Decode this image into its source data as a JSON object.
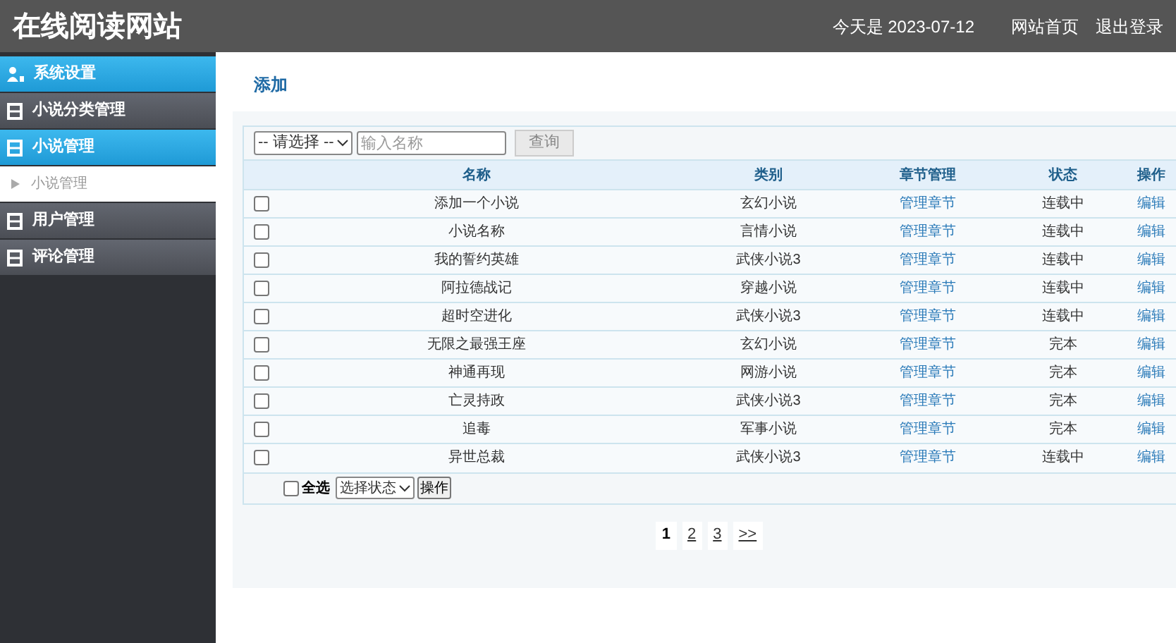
{
  "header": {
    "title": "在线阅读网站",
    "date": "今天是 2023-07-12",
    "links": [
      "网站首页",
      "退出登录"
    ]
  },
  "sidebar": {
    "items": [
      {
        "label": "系统设置",
        "kind": "group",
        "selected": true
      },
      {
        "label": "小说分类管理",
        "kind": "group",
        "selected": false
      },
      {
        "label": "小说管理",
        "kind": "group",
        "selected": true
      },
      {
        "label": "小说管理",
        "kind": "sub",
        "selected": false
      },
      {
        "label": "用户管理",
        "kind": "group",
        "selected": false
      },
      {
        "label": "评论管理",
        "kind": "group",
        "selected": false
      }
    ]
  },
  "add_link": "添加",
  "filter": {
    "select": "-- 请选择 --",
    "placeholder": "输入名称",
    "button": "查询"
  },
  "table": {
    "columns": [
      "名称",
      "类别",
      "章节管理",
      "状态",
      "操作"
    ],
    "rows": [
      {
        "checked": false,
        "name": "添加一个小说",
        "category": "玄幻小说",
        "chapters": "管理章节",
        "status": "连载中",
        "action": "编辑"
      },
      {
        "checked": false,
        "name": "小说名称",
        "category": "言情小说",
        "chapters": "管理章节",
        "status": "连载中",
        "action": "编辑"
      },
      {
        "checked": false,
        "name": "我的誓约英雄",
        "category": "武侠小说3",
        "chapters": "管理章节",
        "status": "连载中",
        "action": "编辑"
      },
      {
        "checked": false,
        "name": "阿拉德战记",
        "category": "穿越小说",
        "chapters": "管理章节",
        "status": "连载中",
        "action": "编辑"
      },
      {
        "checked": false,
        "name": "超时空进化",
        "category": "武侠小说3",
        "chapters": "管理章节",
        "status": "连载中",
        "action": "编辑"
      },
      {
        "checked": false,
        "name": "无限之最强王座",
        "category": "玄幻小说",
        "chapters": "管理章节",
        "status": "完本",
        "action": "编辑"
      },
      {
        "checked": false,
        "name": "神通再现",
        "category": "网游小说",
        "chapters": "管理章节",
        "status": "完本",
        "action": "编辑"
      },
      {
        "checked": false,
        "name": "亡灵持政",
        "category": "武侠小说3",
        "chapters": "管理章节",
        "status": "完本",
        "action": "编辑"
      },
      {
        "checked": false,
        "name": "追毒",
        "category": "军事小说",
        "chapters": "管理章节",
        "status": "完本",
        "action": "编辑"
      },
      {
        "checked": false,
        "name": "异世总裁",
        "category": "武侠小说3",
        "chapters": "管理章节",
        "status": "连载中",
        "action": "编辑"
      }
    ],
    "footer": {
      "select_all": {
        "label": "全选",
        "checked": false
      },
      "status_select": "选择状态",
      "button": "操作"
    }
  },
  "pagination": [
    {
      "label": "1",
      "selected": true
    },
    {
      "label": "2",
      "selected": false
    },
    {
      "label": "3",
      "selected": false
    },
    {
      "label": ">>",
      "selected": false
    }
  ]
}
